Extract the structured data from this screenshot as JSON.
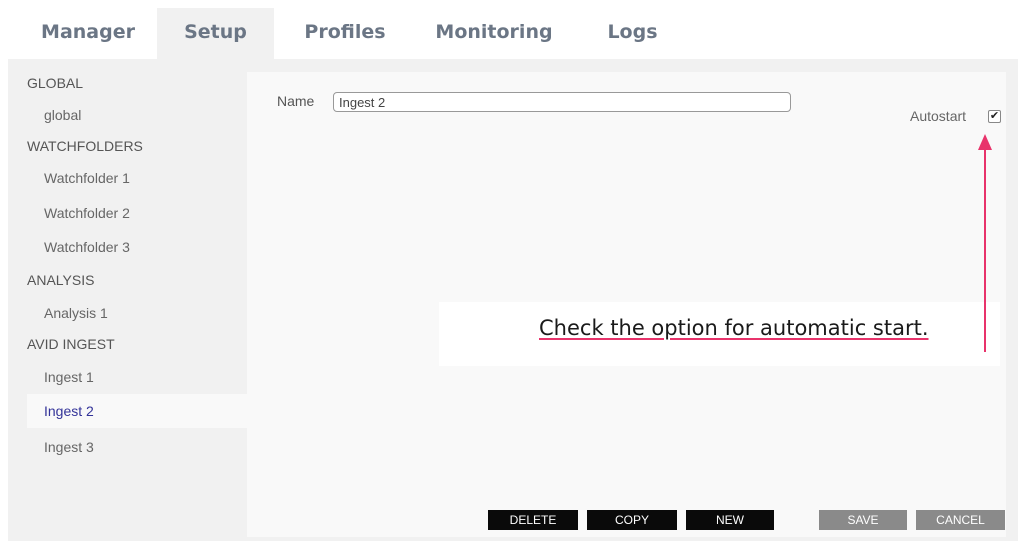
{
  "tabs": [
    {
      "label": "Manager"
    },
    {
      "label": "Setup"
    },
    {
      "label": "Profiles"
    },
    {
      "label": "Monitoring"
    },
    {
      "label": "Logs"
    }
  ],
  "active_tab": "Setup",
  "sidebar": {
    "items": [
      {
        "label": "GLOBAL",
        "type": "group"
      },
      {
        "label": "global",
        "type": "child"
      },
      {
        "label": "WATCHFOLDERS",
        "type": "group"
      },
      {
        "label": "Watchfolder 1",
        "type": "child"
      },
      {
        "label": "Watchfolder 2",
        "type": "child"
      },
      {
        "label": "Watchfolder 3",
        "type": "child"
      },
      {
        "label": "ANALYSIS",
        "type": "group"
      },
      {
        "label": "Analysis 1",
        "type": "child"
      },
      {
        "label": "AVID INGEST",
        "type": "group"
      },
      {
        "label": "Ingest 1",
        "type": "child"
      },
      {
        "label": "Ingest 2",
        "type": "child",
        "selected": true
      },
      {
        "label": "Ingest 3",
        "type": "child"
      }
    ]
  },
  "form": {
    "name_label": "Name",
    "name_value": "Ingest 2",
    "autostart_label": "Autostart",
    "autostart_checked": true
  },
  "callout": {
    "text": "Check the option for automatic start."
  },
  "buttons": {
    "delete": "DELETE",
    "copy": "COPY",
    "new": "NEW",
    "save": "SAVE",
    "cancel": "CANCEL"
  },
  "colors": {
    "tab_text": "#6b7685",
    "selected_item": "#333399",
    "arrow": "#e8336b",
    "dark_button": "#0a0a0a",
    "gray_button": "#8a8a8a"
  }
}
